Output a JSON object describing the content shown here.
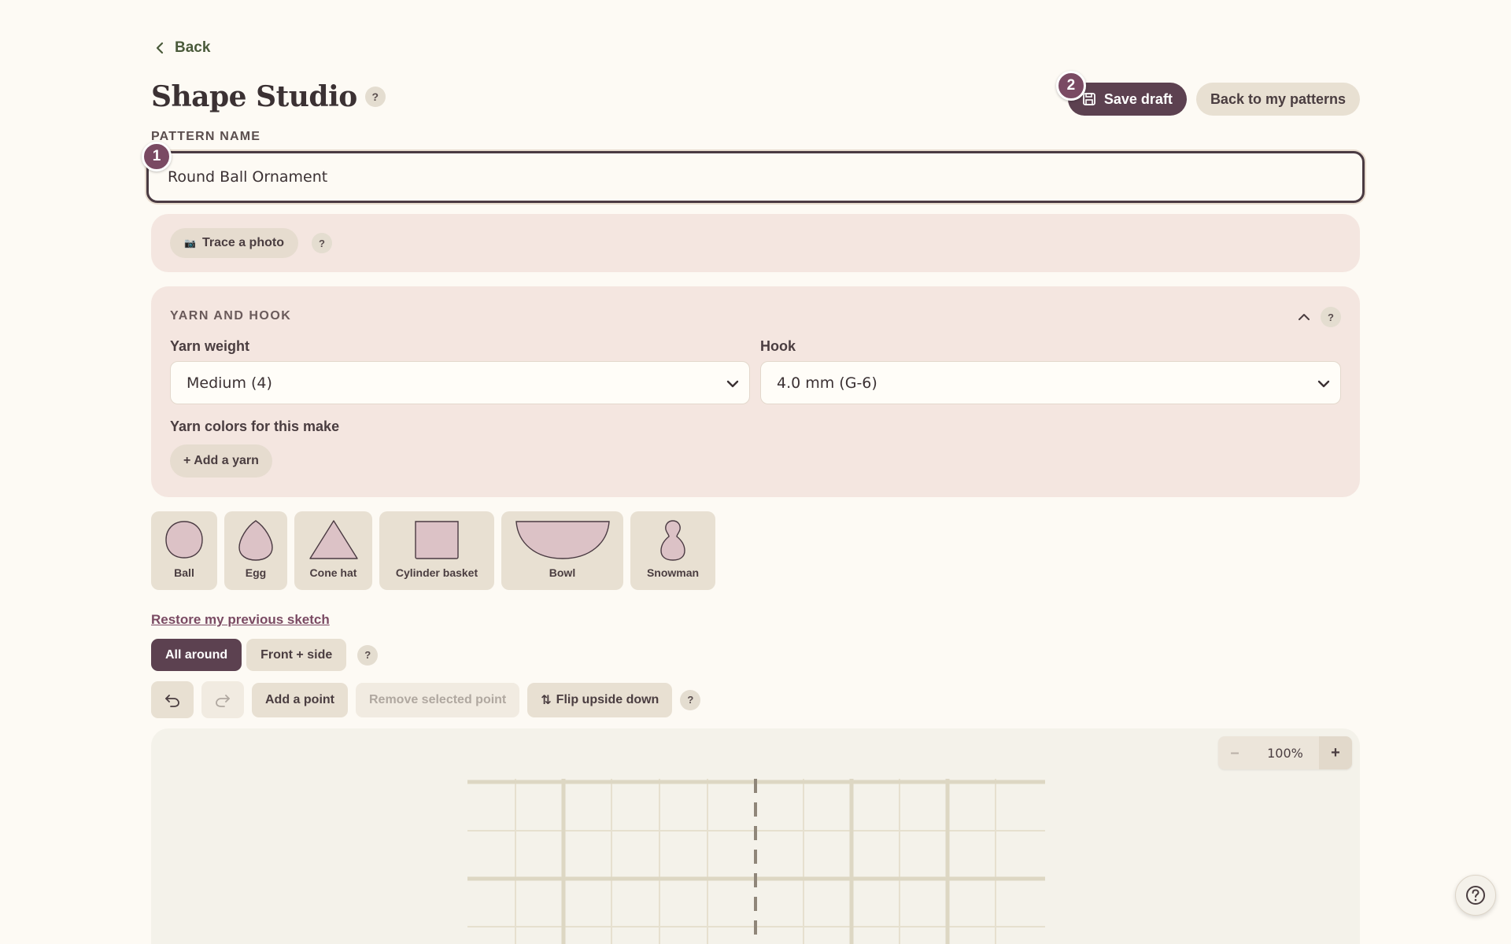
{
  "nav": {
    "back_label": "Back"
  },
  "header": {
    "title": "Shape Studio",
    "help": "?",
    "save_label": "Save draft",
    "back_patterns_label": "Back to my patterns",
    "save_step": "2"
  },
  "pattern": {
    "label": "PATTERN NAME",
    "value": "Round Ball Ornament",
    "step": "1"
  },
  "trace": {
    "label": "Trace a photo",
    "icon": "📷",
    "help": "?"
  },
  "yarn": {
    "title": "YARN AND HOOK",
    "help": "?",
    "weight_label": "Yarn weight",
    "weight_value": "Medium (4)",
    "hook_label": "Hook",
    "hook_value": "4.0 mm (G-6)",
    "colors_label": "Yarn colors for this make",
    "add_label": "+ Add a yarn"
  },
  "shapes": [
    {
      "label": "Ball"
    },
    {
      "label": "Egg"
    },
    {
      "label": "Cone hat"
    },
    {
      "label": "Cylinder basket"
    },
    {
      "label": "Bowl"
    },
    {
      "label": "Snowman"
    }
  ],
  "restore_label": "Restore my previous sketch",
  "view": {
    "all_around": "All around",
    "front_side": "Front + side",
    "help": "?"
  },
  "tools": {
    "add_point": "Add a point",
    "remove_point": "Remove selected point",
    "flip": "Flip upside down",
    "flip_icon": "⇅",
    "help": "?"
  },
  "zoom": {
    "minus": "–",
    "value": "100%",
    "plus": "+"
  },
  "colors": {
    "primary": "#5c4150",
    "badge": "#7a4a63",
    "panel": "#f4e6e0",
    "shape_fill": "#dcc2c6"
  }
}
